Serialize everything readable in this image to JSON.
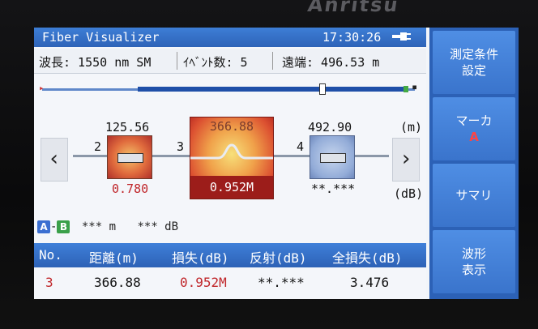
{
  "device": {
    "brand": "Anritsu"
  },
  "title_bar": {
    "app_name": "Fiber Visualizer",
    "time": "17:30:26"
  },
  "info_bar": {
    "wavelength": "波長: 1550 nm SM",
    "event_count": "ｲﾍﾞﾝﾄ数: 5",
    "far_end": "遠端: 496.53 m"
  },
  "events": {
    "units_distance": "(m)",
    "units_loss": "(dB)",
    "items": [
      {
        "number": "2",
        "distance": "125.56",
        "loss": "0.780"
      },
      {
        "number": "3",
        "distance": "366.88",
        "loss": "0.952M"
      },
      {
        "number": "4",
        "distance": "492.90",
        "loss": "**.***"
      }
    ]
  },
  "ab_marker": {
    "a": "A",
    "b": "B",
    "distance": "*** m",
    "loss": "*** dB"
  },
  "table": {
    "headers": [
      "No.",
      "距離(m)",
      "損失(dB)",
      "反射(dB)",
      "全損失(dB)"
    ],
    "row": [
      "3",
      "366.88",
      "0.952M",
      "**.***",
      "3.476"
    ]
  },
  "side_buttons": [
    {
      "label": "測定条件\n設定"
    },
    {
      "label": "マーカ",
      "sub": "A"
    },
    {
      "label": "サマリ"
    },
    {
      "label": "波形\n表示"
    }
  ],
  "colors": {
    "title_blue": "#2e63b8",
    "side_blue": "#3a74cc",
    "loss_red": "#c0262a"
  }
}
